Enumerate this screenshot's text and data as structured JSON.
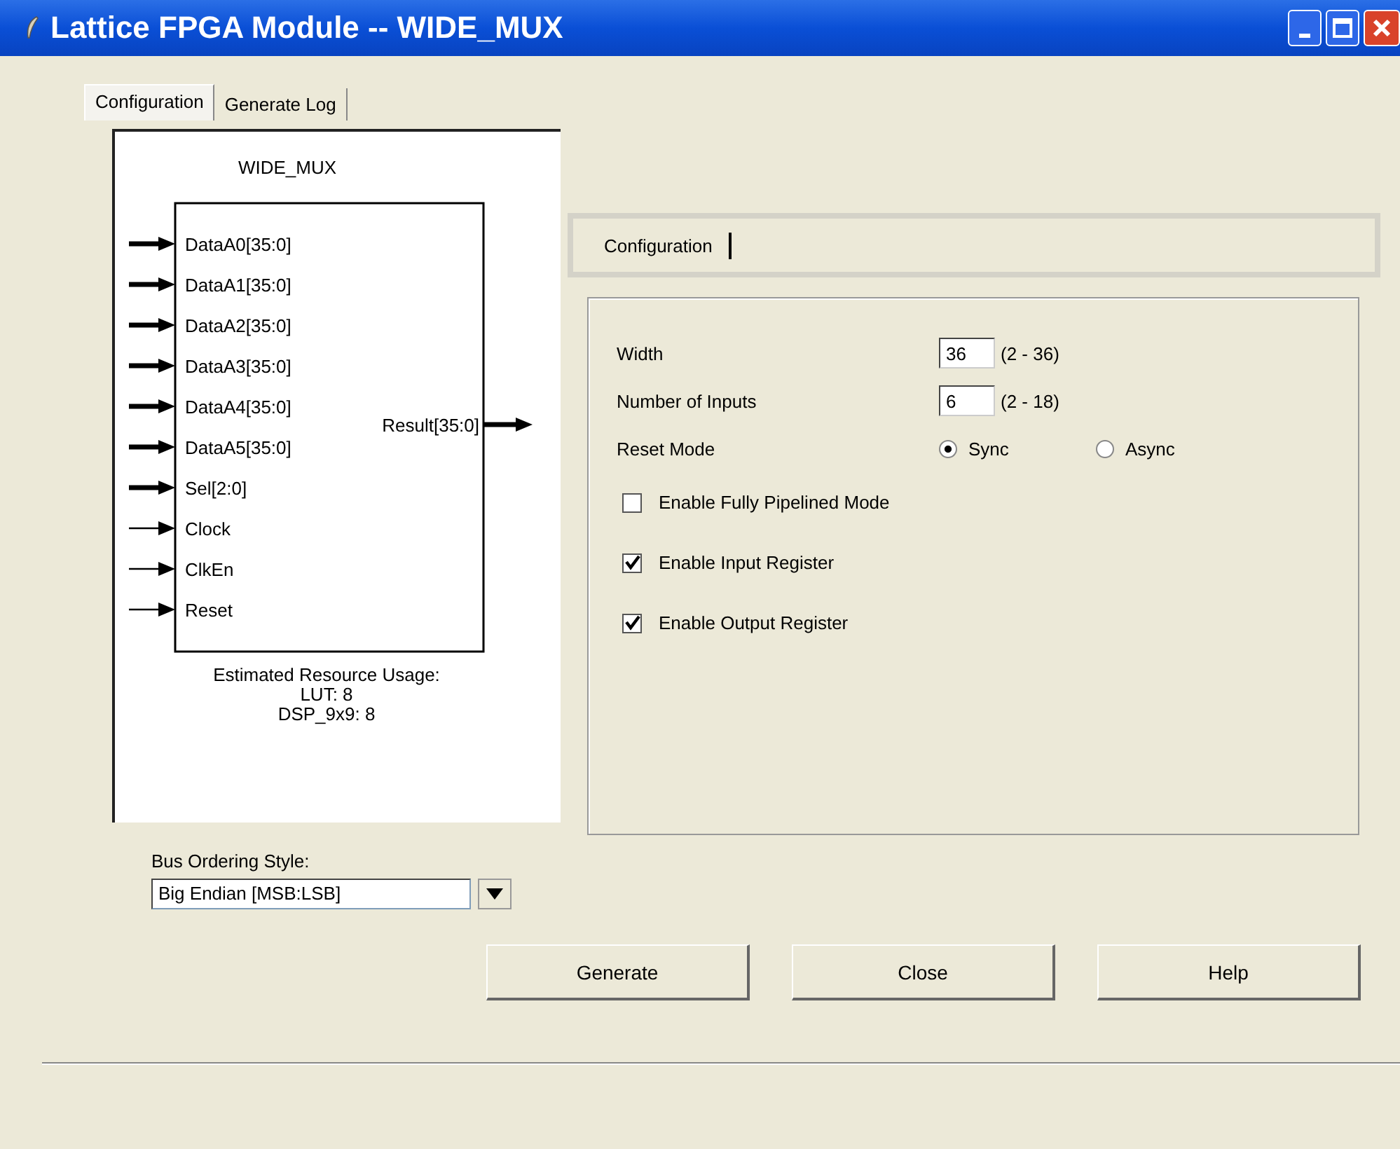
{
  "window": {
    "title": "Lattice FPGA Module -- WIDE_MUX"
  },
  "tabs": [
    {
      "label": "Configuration",
      "selected": true
    },
    {
      "label": "Generate Log",
      "selected": false
    }
  ],
  "diagram": {
    "title": "WIDE_MUX",
    "inputs": [
      {
        "label": "DataA0[35:0]",
        "kind": "bus"
      },
      {
        "label": "DataA1[35:0]",
        "kind": "bus"
      },
      {
        "label": "DataA2[35:0]",
        "kind": "bus"
      },
      {
        "label": "DataA3[35:0]",
        "kind": "bus"
      },
      {
        "label": "DataA4[35:0]",
        "kind": "bus"
      },
      {
        "label": "DataA5[35:0]",
        "kind": "bus"
      },
      {
        "label": "Sel[2:0]",
        "kind": "bus"
      },
      {
        "label": "Clock",
        "kind": "single"
      },
      {
        "label": "ClkEn",
        "kind": "single"
      },
      {
        "label": "Reset",
        "kind": "single"
      }
    ],
    "outputs": [
      {
        "label": "Result[35:0]",
        "kind": "bus"
      }
    ],
    "resource_usage": [
      "Estimated Resource Usage:",
      "LUT: 8",
      "DSP_9x9: 8"
    ]
  },
  "bus_ordering": {
    "label": "Bus Ordering Style:",
    "value": "Big Endian [MSB:LSB]"
  },
  "inner_tabs": [
    {
      "label": "Configuration",
      "selected": true
    }
  ],
  "settings": [
    {
      "kind": "number",
      "label": "Width",
      "value": "36",
      "range": "(2 - 36)"
    },
    {
      "kind": "number",
      "label": "Number of Inputs",
      "value": "6",
      "range": "(2 - 18)"
    },
    {
      "kind": "radio",
      "label": "Reset Mode",
      "options": [
        {
          "label": "Sync",
          "selected": true
        },
        {
          "label": "Async",
          "selected": false
        }
      ]
    },
    {
      "kind": "checkbox",
      "label": "Enable Fully Pipelined Mode",
      "checked": false
    },
    {
      "kind": "checkbox",
      "label": "Enable Input Register",
      "checked": true
    },
    {
      "kind": "checkbox",
      "label": "Enable Output Register",
      "checked": true
    }
  ],
  "buttons": [
    "Generate",
    "Close",
    "Help"
  ]
}
